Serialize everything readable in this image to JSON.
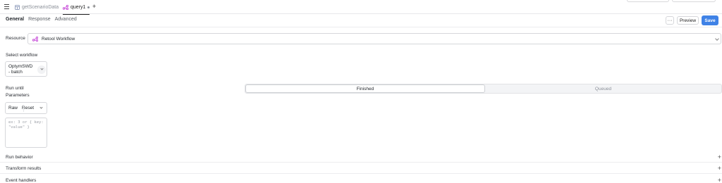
{
  "tabs": {
    "inactive_label": "getScenarioData",
    "active_label": "query1",
    "add_label": "+"
  },
  "subtabs": {
    "general": "General",
    "response": "Response",
    "advanced": "Advanced"
  },
  "actions": {
    "more": "···",
    "preview": "Preview",
    "save": "Save"
  },
  "resource": {
    "label": "Resource",
    "value": "Retool Workflow"
  },
  "workflow": {
    "label": "Select workflow",
    "value": "OptymSWD - batch"
  },
  "run_until": {
    "label": "Run until",
    "options": [
      "Finished",
      "Queued"
    ],
    "selected": "Finished"
  },
  "parameters": {
    "label": "Parameters",
    "mode": "Raw",
    "reset": "Reset t",
    "placeholder": "ex: 3 or { key: \"value\" }"
  },
  "sections": [
    {
      "label": "Run behavior",
      "icon": "plus-icon"
    },
    {
      "label": "Transform results",
      "icon": "plus-icon"
    },
    {
      "label": "Event handlers",
      "icon": "plus-icon"
    }
  ],
  "colors": {
    "accent": "#3f82e6",
    "workflow_icon": "#c64bd8"
  }
}
